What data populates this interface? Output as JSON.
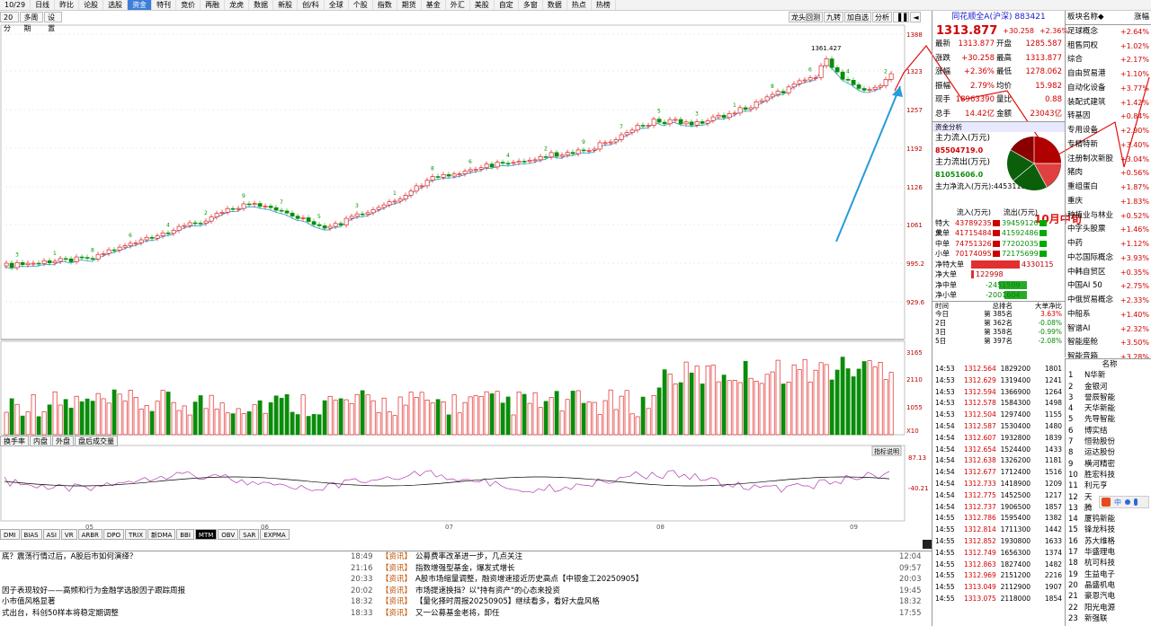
{
  "topbar": [
    "10/29",
    "日线",
    "昨比",
    "论股",
    "选股",
    "资金",
    "特刊",
    "竞价",
    "再融",
    "龙虎",
    "数据",
    "新股",
    "创/科",
    "全球",
    "个股",
    "指数",
    "期货",
    "基金",
    "外汇",
    "美股",
    "自定",
    "多窗",
    "数据",
    "热点",
    "热榜"
  ],
  "subbar": [
    "20分",
    "多周期",
    "设置"
  ],
  "charttools": [
    "龙头回测",
    "九转",
    "加自选",
    "分析",
    "▐▐",
    "◄"
  ],
  "pricechart": {
    "ylabels": [
      "1388",
      "1323",
      "1257",
      "1192",
      "1126",
      "1061",
      "995.2",
      "929.6"
    ],
    "hi_label": "1361.427",
    "xlabels": [
      "05",
      "06",
      "07",
      "08",
      "09"
    ],
    "annotation": "10月中旬"
  },
  "volchart": {
    "ylabels": [
      "3165",
      "2110",
      "1055",
      "X10"
    ],
    "tabs": [
      "换手率",
      "内盘",
      "外盘",
      "盘后成交量"
    ]
  },
  "oscchart": {
    "ylabels": [
      "87.13",
      "-40.21"
    ],
    "btn": "指标说明"
  },
  "indtabs": [
    "DMI",
    "BIAS",
    "ASI",
    "VR",
    "ARBR",
    "DPO",
    "TRIX",
    "新DMA",
    "BBI",
    "MTM",
    "OBV",
    "SAR",
    "EXPMA"
  ],
  "quote": {
    "title": "同花顺全A(沪深) 883421",
    "price": "1313.877",
    "chg": "+30.258",
    "pct": "+2.36%",
    "rows": [
      {
        "k": "最新",
        "v": "1313.877",
        "k2": "开盘",
        "v2": "1285.587"
      },
      {
        "k": "涨跌",
        "v": "+30.258",
        "k2": "最高",
        "v2": "1313.877"
      },
      {
        "k": "涨幅",
        "v": "+2.36%",
        "k2": "最低",
        "v2": "1278.062"
      },
      {
        "k": "振幅",
        "v": "2.79%",
        "k2": "均价",
        "v2": "15.982"
      },
      {
        "k": "现手",
        "v": "18963390",
        "k2": "量比",
        "v2": "0.88"
      },
      {
        "k": "总手",
        "v": "14.42亿",
        "k2": "金额",
        "v2": "23043亿"
      }
    ],
    "capital": "资金分析",
    "inflow_label": "主力流入(万元)",
    "inflow": "85504719.0",
    "outflow_label": "主力流出(万元)",
    "outflow": "81051606.0",
    "net_label": "主力净流入(万元)",
    "net": "4453113.0",
    "flow_head": [
      "流入(万元)",
      "流出(万元)"
    ],
    "flows": [
      {
        "n": "特大单",
        "a": "43789235",
        "b": "39459120"
      },
      {
        "n": "大单",
        "a": "41715484",
        "b": "41592486"
      },
      {
        "n": "中单",
        "a": "74751326",
        "b": "77202035"
      },
      {
        "n": "小单",
        "a": "70174095",
        "b": "72175699"
      }
    ],
    "nets": [
      {
        "n": "净特大单",
        "v": "4330115",
        "w": 0.96,
        "c": "#e03030"
      },
      {
        "n": "净大单",
        "v": "122998",
        "w": 0.05,
        "c": "#e03030"
      },
      {
        "n": "净中单",
        "v": "-2451509",
        "w": 0.55,
        "c": "#2aa82a"
      },
      {
        "n": "净小单",
        "v": "-2001604",
        "w": 0.45,
        "c": "#2aa82a"
      }
    ],
    "rank_head": [
      "时间",
      "总排名",
      "大单净比"
    ],
    "ranks": [
      {
        "d": "今日",
        "r": "第 385名",
        "p": "3.63%"
      },
      {
        "d": "2日",
        "r": "第 362名",
        "p": "-0.08%"
      },
      {
        "d": "3日",
        "r": "第 358名",
        "p": "-0.99%"
      },
      {
        "d": "5日",
        "r": "第 397名",
        "p": "-2.08%"
      }
    ]
  },
  "ticks": [
    [
      "14:53",
      "1312.564",
      "1829200",
      "1801"
    ],
    [
      "14:53",
      "1312.629",
      "1319400",
      "1241"
    ],
    [
      "14:53",
      "1312.594",
      "1366900",
      "1264"
    ],
    [
      "14:53",
      "1312.578",
      "1584300",
      "1498"
    ],
    [
      "14:53",
      "1312.504",
      "1297400",
      "1155"
    ],
    [
      "14:54",
      "1312.587",
      "1530400",
      "1480"
    ],
    [
      "14:54",
      "1312.607",
      "1932800",
      "1839"
    ],
    [
      "14:54",
      "1312.654",
      "1524400",
      "1433"
    ],
    [
      "14:54",
      "1312.638",
      "1326200",
      "1181"
    ],
    [
      "14:54",
      "1312.677",
      "1712400",
      "1516"
    ],
    [
      "14:54",
      "1312.733",
      "1418900",
      "1209"
    ],
    [
      "14:54",
      "1312.775",
      "1452500",
      "1217"
    ],
    [
      "14:54",
      "1312.737",
      "1906500",
      "1857"
    ],
    [
      "14:55",
      "1312.786",
      "1595400",
      "1382"
    ],
    [
      "14:55",
      "1312.814",
      "1711300",
      "1442"
    ],
    [
      "14:55",
      "1312.852",
      "1930800",
      "1633"
    ],
    [
      "14:55",
      "1312.749",
      "1656300",
      "1374"
    ],
    [
      "14:55",
      "1312.863",
      "1827400",
      "1482"
    ],
    [
      "14:55",
      "1312.969",
      "2151200",
      "2216"
    ],
    [
      "14:55",
      "1313.049",
      "2112900",
      "1907"
    ],
    [
      "14:55",
      "1313.075",
      "2118000",
      "1854"
    ]
  ],
  "board_head": [
    "板块名称◆",
    "涨幅"
  ],
  "board": [
    [
      "足球概念",
      "+2.64%"
    ],
    [
      "租售同权",
      "+1.02%"
    ],
    [
      "综合",
      "+2.17%"
    ],
    [
      "自由贸易港",
      "+1.10%"
    ],
    [
      "自动化设备",
      "+3.77%"
    ],
    [
      "装配式建筑",
      "+1.42%"
    ],
    [
      "转基因",
      "+0.84%"
    ],
    [
      "专用设备",
      "+2.90%"
    ],
    [
      "专精特新",
      "+3.40%"
    ],
    [
      "注册制次新股",
      "+3.04%"
    ],
    [
      "猪肉",
      "+0.56%"
    ],
    [
      "重组蛋白",
      "+1.87%"
    ],
    [
      "重庆",
      "+1.83%"
    ],
    [
      "种植业与林业",
      "+0.52%"
    ],
    [
      "中字头股票",
      "+1.46%"
    ],
    [
      "中药",
      "+1.12%"
    ],
    [
      "中芯国际概念",
      "+3.93%"
    ],
    [
      "中韩自贸区",
      "+0.35%"
    ],
    [
      "中国AI 50",
      "+2.75%"
    ],
    [
      "中俄贸易概念",
      "+2.33%"
    ],
    [
      "中船系",
      "+1.40%"
    ],
    [
      "智谱AI",
      "+2.32%"
    ],
    [
      "智能座舱",
      "+3.50%"
    ],
    [
      "智能音箱",
      "+3.28%"
    ]
  ],
  "stocks_head": "名称",
  "stocks": [
    [
      "1",
      "N华新"
    ],
    [
      "2",
      "金银河"
    ],
    [
      "3",
      "誉辰智能"
    ],
    [
      "4",
      "天华新能"
    ],
    [
      "5",
      "先导智能"
    ],
    [
      "6",
      "博实结"
    ],
    [
      "7",
      "恒勃股份"
    ],
    [
      "8",
      "运达股份"
    ],
    [
      "9",
      "横河精密"
    ],
    [
      "10",
      "胜宏科技"
    ],
    [
      "11",
      "利元亨"
    ],
    [
      "12",
      "天"
    ],
    [
      "13",
      "腾"
    ],
    [
      "14",
      "厦钨新能"
    ],
    [
      "15",
      "锋龙科技"
    ],
    [
      "16",
      "苏大维格"
    ],
    [
      "17",
      "华盛理电"
    ],
    [
      "18",
      "杭可科技"
    ],
    [
      "19",
      "生益电子"
    ],
    [
      "20",
      "晶盛机电"
    ],
    [
      "21",
      "豪恩汽电"
    ],
    [
      "22",
      "阳光电源"
    ],
    [
      "23",
      "新强联"
    ]
  ],
  "news": [
    {
      "l": "底？震荡行情过后，A股后市如何演绎？",
      "t": "18:49",
      "tag": "【资讯】",
      "h": "公募费率改革进一步，几点关注",
      "d": "12:04"
    },
    {
      "l": "",
      "t": "21:16",
      "tag": "【资讯】",
      "h": "指数增强型基金，爆发式增长",
      "d": "09:57"
    },
    {
      "l": "",
      "t": "20:33",
      "tag": "【资讯】",
      "h": "A股市场缩量调整，融资增速接近历史高点【中银金工20250905】",
      "d": "20:03"
    },
    {
      "l": "因子表现较好——高频和行为金融学选股因子跟踪周报",
      "t": "20:02",
      "tag": "【资讯】",
      "h": "市场提速换挡？以\"持有资产\"的心态来投资",
      "d": "19:45"
    },
    {
      "l": "小市值风格显著",
      "t": "18:32",
      "tag": "【资讯】",
      "h": "【量化择时周报20250905】继续看多，看好大盘风格",
      "d": "18:32"
    },
    {
      "l": "式出台，科创50样本将稳定期调整",
      "t": "18:33",
      "tag": "【资讯】",
      "h": "又一公募基金老将，卸任",
      "d": "17:55"
    }
  ],
  "colors": {
    "up": "#d10000",
    "down": "#0a8d0a",
    "annot": "#e01010",
    "arrow": "#2a9ad8"
  }
}
